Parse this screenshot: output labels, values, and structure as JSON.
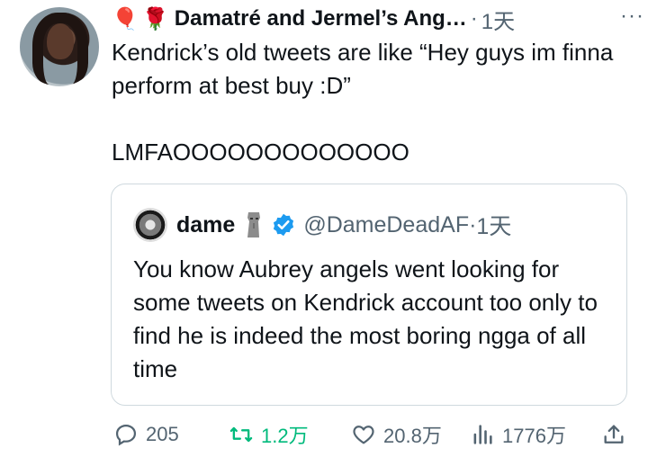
{
  "tweet": {
    "display_name": "Damatré and Jermel’s Ang…",
    "time": "1天",
    "separator": "·",
    "more": "···",
    "text": "Kendrick’s old tweets are like “Hey guys im finna perform at best buy :D”\n\nLMFAOOOOOOOOOOOOO",
    "emoji_1": "🎈",
    "emoji_2": "🌹"
  },
  "quote": {
    "name": "dame",
    "handle": "@DameDeadAF",
    "separator": "·",
    "time": "1天",
    "text": "You know Aubrey angels went looking for some tweets on Kendrick account too only to find he is indeed the most boring ngga of all time"
  },
  "actions": {
    "replies": "205",
    "retweets": "1.2万",
    "likes": "20.8万",
    "views": "1776万"
  },
  "colors": {
    "text": "#0f1419",
    "secondary": "#536471",
    "retweet_green": "#00ba7c",
    "verified_blue": "#1d9bf0",
    "border": "#cfd9de"
  }
}
